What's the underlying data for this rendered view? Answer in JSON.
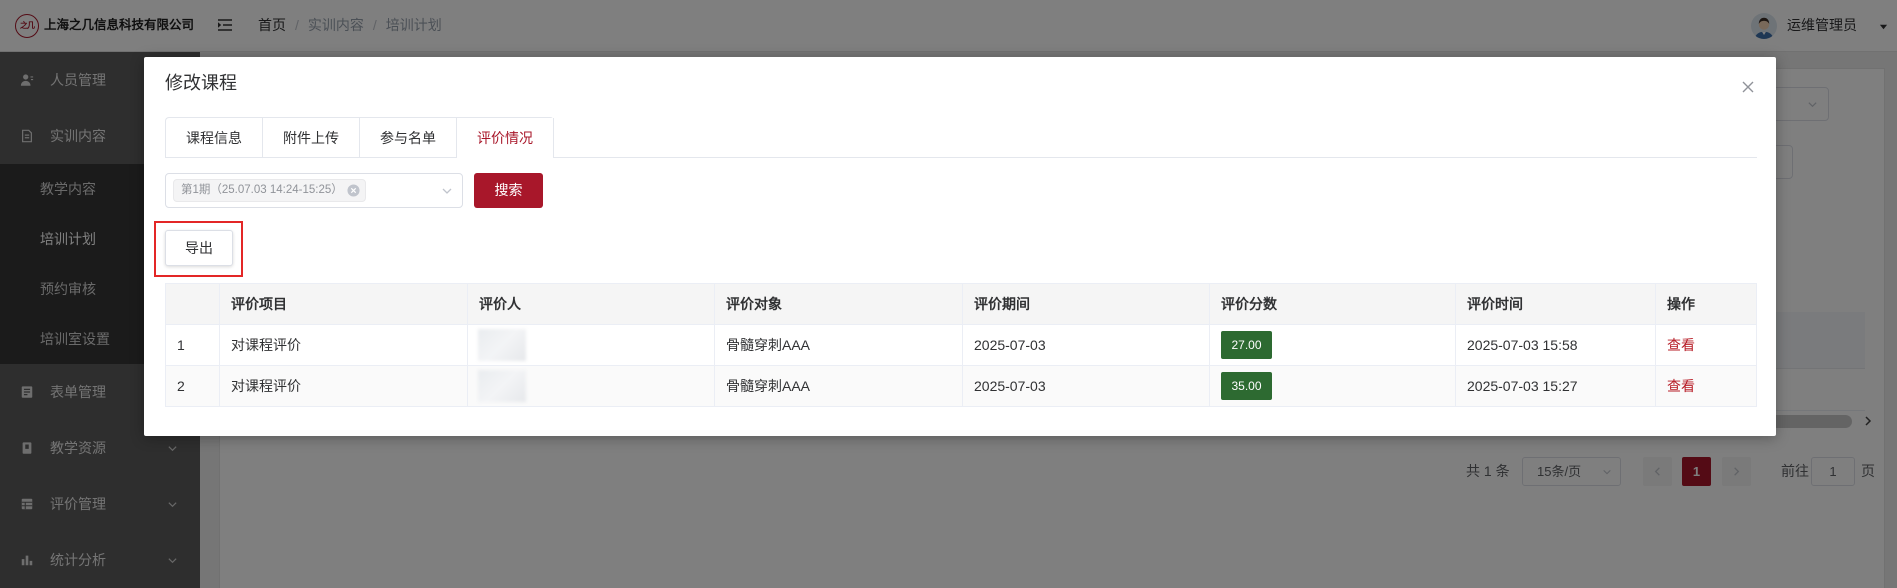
{
  "header": {
    "logo_mark": "之几",
    "company_name": "上海之几信息科技有限公司",
    "breadcrumb": {
      "home": "首页",
      "separator": "/",
      "section": "实训内容",
      "current": "培训计划"
    },
    "user_name": "运维管理员"
  },
  "sidebar": {
    "items": [
      {
        "label": "人员管理",
        "icon": "user-icon"
      },
      {
        "label": "实训内容",
        "icon": "clipboard-icon",
        "expanded": true,
        "children": [
          "教学内容",
          "培训计划",
          "预约审核",
          "培训室设置"
        ],
        "active_child": "培训计划"
      },
      {
        "label": "表单管理",
        "icon": "form-icon"
      },
      {
        "label": "教学资源",
        "icon": "book-icon"
      },
      {
        "label": "评价管理",
        "icon": "evaluation-icon"
      },
      {
        "label": "统计分析",
        "icon": "bar-chart-icon"
      }
    ]
  },
  "background_page": {
    "pagination": {
      "total": "共 1 条",
      "page_size": "15条/页",
      "current_page": "1",
      "goto_label": "前往",
      "goto_value": "1",
      "page_suffix": "页"
    }
  },
  "modal": {
    "title": "修改课程",
    "tabs": [
      "课程信息",
      "附件上传",
      "参与名单",
      "评价情况"
    ],
    "active_tab": "评价情况",
    "filter": {
      "selected_period": "第1期（25.07.03 14:24-15:25）"
    },
    "search_button": "搜索",
    "export_button": "导出",
    "table": {
      "columns": [
        "评价项目",
        "评价人",
        "评价对象",
        "评价期间",
        "评价分数",
        "评价时间",
        "操作"
      ],
      "rows": [
        {
          "index": "1",
          "item": "对课程评价",
          "target": "骨髓穿刺AAA",
          "period": "2025-07-03",
          "score": "27.00",
          "time": "2025-07-03 15:58",
          "action": "查看"
        },
        {
          "index": "2",
          "item": "对课程评价",
          "target": "骨髓穿刺AAA",
          "period": "2025-07-03",
          "score": "35.00",
          "time": "2025-07-03 15:27",
          "action": "查看"
        }
      ]
    }
  },
  "colors": {
    "brand_red": "#a8172a",
    "score_badge": "#2d6a31",
    "highlight_border": "#e32626"
  }
}
